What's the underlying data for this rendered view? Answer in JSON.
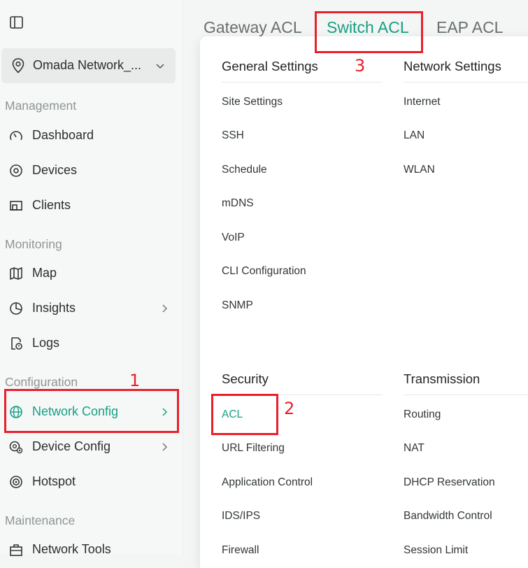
{
  "sidebar": {
    "site_name": "Omada Network_...",
    "sections": {
      "management": "Management",
      "monitoring": "Monitoring",
      "configuration": "Configuration",
      "maintenance": "Maintenance"
    },
    "items": {
      "dashboard": "Dashboard",
      "devices": "Devices",
      "clients": "Clients",
      "map": "Map",
      "insights": "Insights",
      "logs": "Logs",
      "network_config": "Network Config",
      "device_config": "Device Config",
      "hotspot": "Hotspot",
      "network_tools": "Network Tools"
    }
  },
  "tabs": {
    "gateway_acl": "Gateway ACL",
    "switch_acl": "Switch ACL",
    "eap_acl": "EAP ACL"
  },
  "menu": {
    "general_settings": {
      "title": "General Settings",
      "items": [
        "Site Settings",
        "SSH",
        "Schedule",
        "mDNS",
        "VoIP",
        "CLI Configuration",
        "SNMP"
      ]
    },
    "network_settings": {
      "title": "Network Settings",
      "items": [
        "Internet",
        "LAN",
        "WLAN"
      ]
    },
    "security": {
      "title": "Security",
      "items": [
        "ACL",
        "URL Filtering",
        "Application Control",
        "IDS/IPS",
        "Firewall"
      ]
    },
    "transmission": {
      "title": "Transmission",
      "items": [
        "Routing",
        "NAT",
        "DHCP Reservation",
        "Bandwidth Control",
        "Session Limit"
      ]
    }
  },
  "annotations": {
    "n1": "1",
    "n2": "2",
    "n3": "3",
    "color": "#e8202a"
  },
  "colors": {
    "accent": "#16a085",
    "annotation": "#e8202a"
  }
}
